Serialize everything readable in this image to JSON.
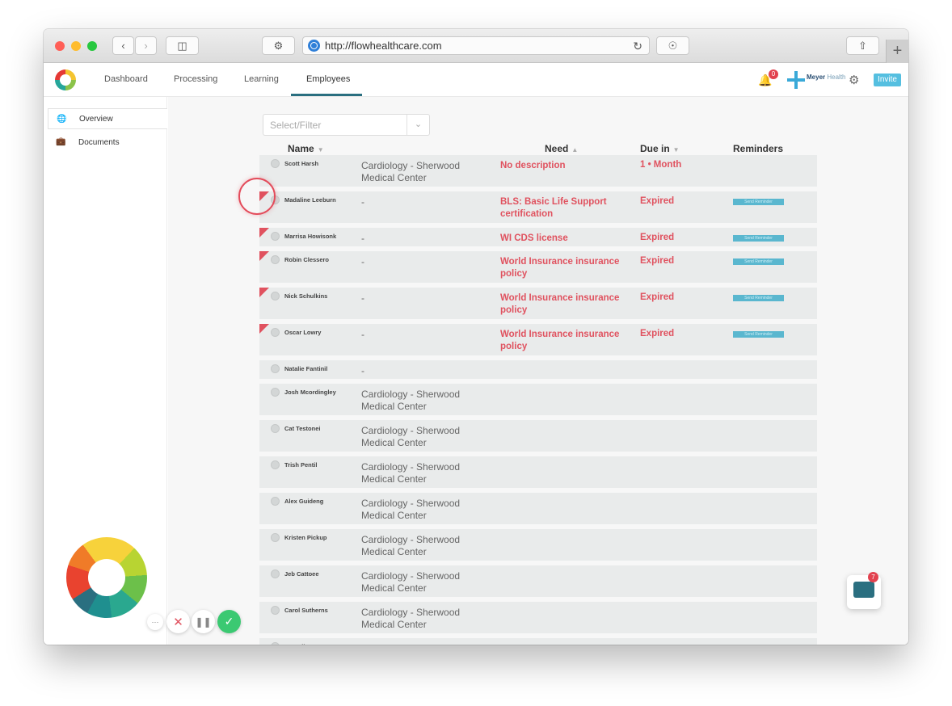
{
  "browser": {
    "url": "http://flowhealthcare.com"
  },
  "nav": {
    "items": [
      "Dashboard",
      "Processing",
      "Learning",
      "Employees"
    ],
    "active": "Employees",
    "notification_count": "0",
    "brand_name": "Meyer",
    "brand_suffix": "Health",
    "invite_label": "Invite"
  },
  "sidebar": {
    "items": [
      "Overview",
      "Documents"
    ]
  },
  "filter": {
    "placeholder": "Select/Filter"
  },
  "table": {
    "headers": {
      "name": "Name",
      "need": "Need",
      "due": "Due in",
      "reminders": "Reminders"
    },
    "reminder_label": "Send Reminder",
    "rows": [
      {
        "name": "Scott Harsh",
        "dept": "Cardiology - Sherwood Medical Center",
        "need": "No description",
        "due": "1 • Month",
        "reminder": false,
        "flag": false
      },
      {
        "name": "Madaline Leeburn",
        "dept": "-",
        "need": "BLS: Basic Life Support certification",
        "due": "Expired",
        "reminder": true,
        "flag": true
      },
      {
        "name": "Marrisa Howisonk",
        "dept": "-",
        "need": "WI CDS license",
        "due": "Expired",
        "reminder": true,
        "flag": true
      },
      {
        "name": "Robin Clessero",
        "dept": "-",
        "need": "World Insurance insurance policy",
        "due": "Expired",
        "reminder": true,
        "flag": true
      },
      {
        "name": "Nick Schulkins",
        "dept": "-",
        "need": "World Insurance insurance policy",
        "due": "Expired",
        "reminder": true,
        "flag": true
      },
      {
        "name": "Oscar Lowry",
        "dept": "-",
        "need": "World Insurance insurance policy",
        "due": "Expired",
        "reminder": true,
        "flag": true
      },
      {
        "name": "Natalie Fantinil",
        "dept": "-",
        "need": "",
        "due": "",
        "reminder": false,
        "flag": false
      },
      {
        "name": "Josh Mcordingley",
        "dept": "Cardiology - Sherwood Medical Center",
        "need": "",
        "due": "",
        "reminder": false,
        "flag": false
      },
      {
        "name": "Cat Testonei",
        "dept": "Cardiology - Sherwood Medical Center",
        "need": "",
        "due": "",
        "reminder": false,
        "flag": false
      },
      {
        "name": "Trish Pentil",
        "dept": "Cardiology - Sherwood Medical Center",
        "need": "",
        "due": "",
        "reminder": false,
        "flag": false
      },
      {
        "name": "Alex Guideng",
        "dept": "Cardiology - Sherwood Medical Center",
        "need": "",
        "due": "",
        "reminder": false,
        "flag": false
      },
      {
        "name": "Kristen Pickup",
        "dept": "Cardiology - Sherwood Medical Center",
        "need": "",
        "due": "",
        "reminder": false,
        "flag": false
      },
      {
        "name": "Jeb Cattoee",
        "dept": "Cardiology - Sherwood Medical Center",
        "need": "",
        "due": "",
        "reminder": false,
        "flag": false
      },
      {
        "name": "Carol Sutherns",
        "dept": "Cardiology - Sherwood Medical Center",
        "need": "",
        "due": "",
        "reminder": false,
        "flag": false
      },
      {
        "name": "Izzy Hiley",
        "dept": "Cardiology - Sherwood",
        "need": "",
        "due": "",
        "reminder": false,
        "flag": false
      }
    ]
  },
  "chat": {
    "unread": "7"
  },
  "colors": {
    "accent": "#2a6f80",
    "alert": "#e0525f",
    "reminder": "#5ab7cf",
    "invite": "#55bfe0"
  }
}
